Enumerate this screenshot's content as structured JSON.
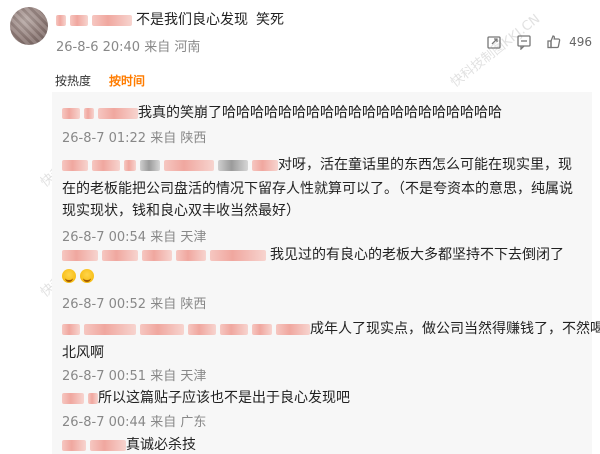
{
  "main": {
    "text_prefix": "不是我们良心发现",
    "text_suffix": "笑死",
    "meta": "26-8-6 20:40 来自 河南",
    "like_count": "496"
  },
  "sort": {
    "hot": "按热度",
    "time": "按时间"
  },
  "replies": [
    {
      "text": "我真的笑崩了哈哈哈哈哈哈哈哈哈哈哈哈哈哈哈哈哈哈哈哈",
      "meta": "26-8-7 01:22 来自 陕西"
    },
    {
      "line1": "对呀，活在童话里的东西怎么可能在现实里，现",
      "line2": "在的老板能把公司盘活的情况下留存人性就算可以了。（不是夸资本的意思，纯属说",
      "line3": "现实现状，钱和良心双丰收当然最好）",
      "meta": "26-8-7 00:54 来自 天津"
    },
    {
      "text": "我见过的有良心的老板大多都坚持不下去倒闭了",
      "meta": "26-8-7 00:52 来自 陕西"
    },
    {
      "line1": "成年人了现实点，做公司当然得赚钱了，不然喝西",
      "line2": "北风啊",
      "meta": "26-8-7 00:51 来自 天津"
    },
    {
      "text": "所以这篇贴子应该也不是出于良心发现吧",
      "meta": "26-8-7 00:44 来自 广东"
    },
    {
      "text": "真诚必杀技"
    }
  ],
  "watermark": "快科技制图KKJ.CN",
  "colors": {
    "accent": "#ff7c00",
    "meta": "#888888",
    "reply_bg": "#f7f7f7"
  },
  "icons": [
    "share-icon",
    "comment-icon",
    "like-icon",
    "laugh-cry-emoji"
  ]
}
